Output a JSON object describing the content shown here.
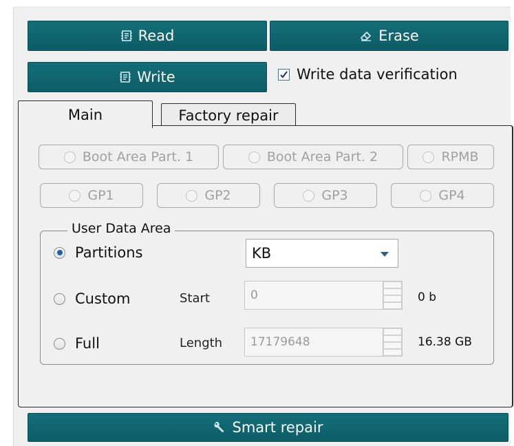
{
  "toolbar": {
    "read_label": "Read",
    "erase_label": "Erase",
    "write_label": "Write",
    "write_verification_label": "Write data verification",
    "write_verification_checked": true
  },
  "tabs": [
    {
      "label": "Main",
      "active": true
    },
    {
      "label": "Factory repair",
      "active": false
    }
  ],
  "partitions": {
    "row1": [
      "Boot Area Part. 1",
      "Boot Area Part. 2",
      "RPMB"
    ],
    "row2": [
      "GP1",
      "GP2",
      "GP3",
      "GP4"
    ]
  },
  "user_data_area": {
    "legend": "User Data Area",
    "partitions_label": "Partitions",
    "custom_label": "Custom",
    "full_label": "Full",
    "selected": "Partitions",
    "unit_select_value": "KB",
    "start_label": "Start",
    "start_value": "0",
    "start_size": "0 b",
    "length_label": "Length",
    "length_value": "17179648",
    "length_size": "16.38 GB"
  },
  "footer": {
    "smart_repair_label": "Smart repair"
  },
  "colors": {
    "button_bg": "#0f6670",
    "accent_radio": "#1f5fae"
  }
}
